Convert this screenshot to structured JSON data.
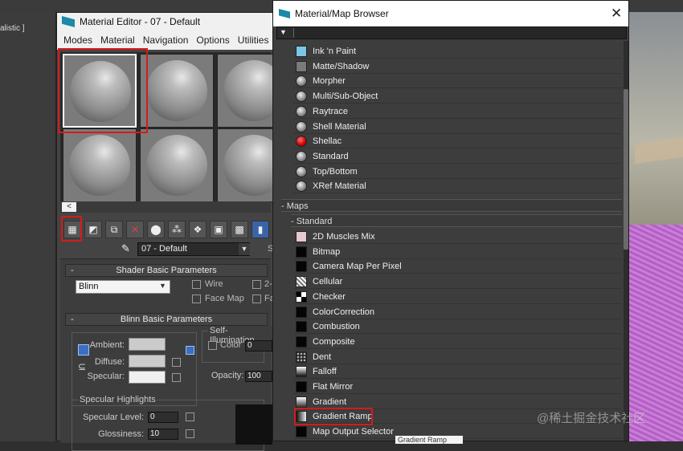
{
  "viewport": {
    "label": "alistic ]"
  },
  "material_editor": {
    "title": "Material Editor - 07 - Default",
    "menu": [
      "Modes",
      "Material",
      "Navigation",
      "Options",
      "Utilities"
    ],
    "tools": [
      "get-material",
      "put-to-scene",
      "assign-to-selection",
      "reset",
      "make-copy",
      "make-unique",
      "put-to-library",
      "material-id",
      "show-in-viewport",
      "show-end-result"
    ],
    "slot_scroll_label": "<",
    "material_name": "07 - Default",
    "shader_rollout": "Shader Basic Parameters",
    "shader_type": "Blinn",
    "wire_label": "Wire",
    "two_sided_label": "2-",
    "face_map_label": "Face Map",
    "faceted_label": "Fa",
    "blinn_rollout": "Blinn Basic Parameters",
    "self_illum_title": "Self-Illumination",
    "color_label": "Color",
    "color_value": "0",
    "ambient_label": "Ambient:",
    "diffuse_label": "Diffuse:",
    "specular_label": "Specular:",
    "opacity_label": "Opacity:",
    "opacity_value": "100",
    "specular_highlights_title": "Specular Highlights",
    "specular_level_label": "Specular Level:",
    "specular_level_value": "0",
    "glossiness_label": "Glossiness:",
    "glossiness_value": "10",
    "s_label": "S"
  },
  "browser": {
    "title": "Material/Map Browser",
    "close": "✕",
    "materials": [
      {
        "label": "Ink 'n Paint",
        "icon": "ink"
      },
      {
        "label": "Matte/Shadow",
        "icon": "matte"
      },
      {
        "label": "Morpher",
        "icon": "ball"
      },
      {
        "label": "Multi/Sub-Object",
        "icon": "ball"
      },
      {
        "label": "Raytrace",
        "icon": "ball"
      },
      {
        "label": "Shell Material",
        "icon": "ball"
      },
      {
        "label": "Shellac",
        "icon": "red"
      },
      {
        "label": "Standard",
        "icon": "ball"
      },
      {
        "label": "Top/Bottom",
        "icon": "ball"
      },
      {
        "label": "XRef Material",
        "icon": "ball"
      }
    ],
    "maps_section": "- Maps",
    "standard_section": "- Standard",
    "maps": [
      {
        "label": "2D Muscles Mix",
        "icon": "map-muscle"
      },
      {
        "label": "Bitmap",
        "icon": "black"
      },
      {
        "label": "Camera Map Per Pixel",
        "icon": "black"
      },
      {
        "label": "Cellular",
        "icon": "cellular"
      },
      {
        "label": "Checker",
        "icon": "checker"
      },
      {
        "label": "ColorCorrection",
        "icon": "black"
      },
      {
        "label": "Combustion",
        "icon": "black"
      },
      {
        "label": "Composite",
        "icon": "black"
      },
      {
        "label": "Dent",
        "icon": "dent"
      },
      {
        "label": "Falloff",
        "icon": "falloff"
      },
      {
        "label": "Flat Mirror",
        "icon": "black"
      },
      {
        "label": "Gradient",
        "icon": "gradient"
      },
      {
        "label": "Gradient Ramp",
        "icon": "gramp"
      },
      {
        "label": "Map Output Selector",
        "icon": "black"
      }
    ],
    "tooltip": "Gradient Ramp"
  },
  "watermark": "@稀土掘金技术社区"
}
